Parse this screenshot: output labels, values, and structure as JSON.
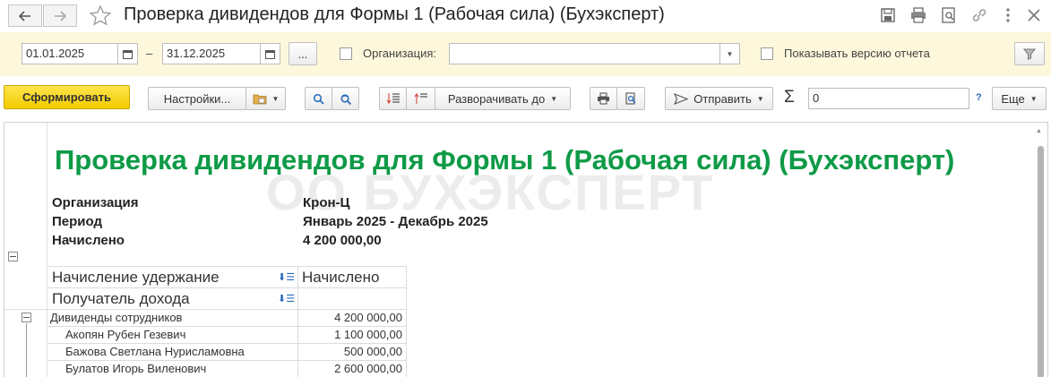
{
  "window": {
    "title": "Проверка дивидендов для Формы 1 (Рабочая сила) (Бухэксперт)",
    "icons": [
      "back-arrow-icon",
      "forward-arrow-icon",
      "star-icon",
      "save-icon",
      "print-icon",
      "preview-icon",
      "link-icon",
      "more-vertical-icon",
      "close-icon"
    ]
  },
  "filters": {
    "date_from": "01.01.2025",
    "separator": "–",
    "date_to": "31.12.2025",
    "ellipsis_label": "...",
    "organization_label": "Организация:",
    "organization_value": "",
    "show_version_label": "Показывать версию отчета"
  },
  "toolbar": {
    "generate_label": "Сформировать",
    "settings_label": "Настройки...",
    "expand_label": "Разворачивать до",
    "send_label": "Отправить",
    "sum_symbol": "Σ",
    "sum_value": "0",
    "help_label": "?",
    "more_label": "Еще"
  },
  "report": {
    "title": "Проверка дивидендов для Формы 1 (Рабочая сила) (Бухэксперт)",
    "watermark": "ОО БУХЭКСПЕРТ",
    "meta": [
      {
        "label": "Организация",
        "value": "Крон-Ц"
      },
      {
        "label": "Период",
        "value": "Январь 2025 - Декабрь 2025"
      },
      {
        "label": "Начислено",
        "value": "4 200 000,00"
      }
    ],
    "headers": {
      "group1": "Начисление удержание",
      "group2": "Получатель дохода",
      "value_col": "Начислено"
    },
    "rows": [
      {
        "name": "Дивиденды сотрудников",
        "value": "4 200 000,00",
        "level": 0
      },
      {
        "name": "Акопян Рубен Гезевич",
        "value": "1 100 000,00",
        "level": 1
      },
      {
        "name": "Бажова Светлана Нурисламовна",
        "value": "500 000,00",
        "level": 1
      },
      {
        "name": "Булатов Игорь Виленович",
        "value": "2 600 000,00",
        "level": 1
      }
    ]
  },
  "colors": {
    "report_title": "#0e9a47",
    "filter_bar_bg": "#fdf8dc",
    "primary_button": "#f2cc00"
  }
}
